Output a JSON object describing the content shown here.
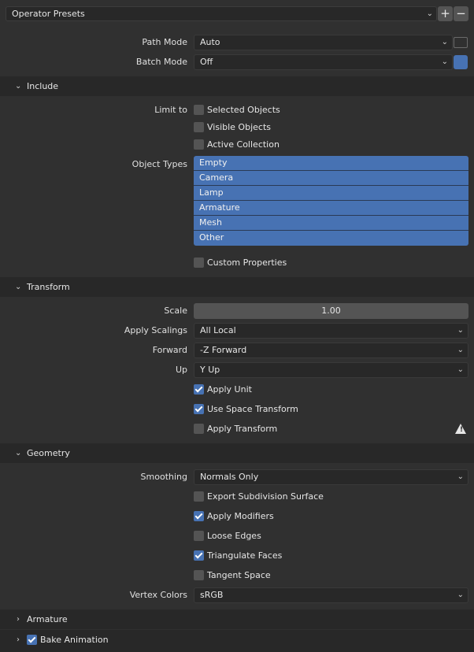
{
  "presets": {
    "label": "Operator Presets",
    "add": "+",
    "remove": "−"
  },
  "path_mode": {
    "label": "Path Mode",
    "value": "Auto"
  },
  "batch_mode": {
    "label": "Batch Mode",
    "value": "Off"
  },
  "include": {
    "title": "Include",
    "limit_to_label": "Limit to",
    "selected_objects": "Selected Objects",
    "visible_objects": "Visible Objects",
    "active_collection": "Active Collection",
    "object_types_label": "Object Types",
    "object_types": [
      "Empty",
      "Camera",
      "Lamp",
      "Armature",
      "Mesh",
      "Other"
    ],
    "custom_properties": "Custom Properties"
  },
  "transform": {
    "title": "Transform",
    "scale_label": "Scale",
    "scale_value": "1.00",
    "apply_scalings_label": "Apply Scalings",
    "apply_scalings_value": "All Local",
    "forward_label": "Forward",
    "forward_value": "-Z Forward",
    "up_label": "Up",
    "up_value": "Y Up",
    "apply_unit": "Apply Unit",
    "use_space_transform": "Use Space Transform",
    "apply_transform": "Apply Transform"
  },
  "geometry": {
    "title": "Geometry",
    "smoothing_label": "Smoothing",
    "smoothing_value": "Normals Only",
    "export_subdivision": "Export Subdivision Surface",
    "apply_modifiers": "Apply Modifiers",
    "loose_edges": "Loose Edges",
    "triangulate_faces": "Triangulate Faces",
    "tangent_space": "Tangent Space",
    "vertex_colors_label": "Vertex Colors",
    "vertex_colors_value": "sRGB"
  },
  "armature": {
    "title": "Armature"
  },
  "bake_animation": {
    "title": "Bake Animation"
  },
  "colors": {
    "accent": "#4772b3",
    "panel_bg": "#303030",
    "header_bg": "#282828"
  }
}
